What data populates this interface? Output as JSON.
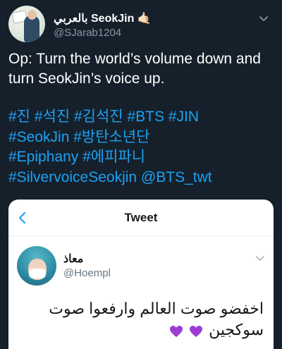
{
  "tweet": {
    "display_name": "بالعربي SeokJin 🤙🏻",
    "handle": "@SJarab1204",
    "text": "Op: Turn the world’s volume down and turn SeokJin’s voice up.",
    "hashtag_lines": [
      "#진 #석진 #김석진 #BTS #JIN",
      "#SeokJin #방탄소년단",
      "#Epiphany #에피파니",
      "#SilvervoiceSeokjin @BTS_twt"
    ]
  },
  "card": {
    "title": "Tweet",
    "quoted": {
      "name": "معاذ",
      "handle": "@Hoempl",
      "text_line1": "اخفضو صوت العالم وارفعوا صوت",
      "text_line2": "سوكجين"
    }
  },
  "colors": {
    "background": "#15202b",
    "link": "#1da1f2",
    "secondary_text": "#8899a6",
    "heart": "#9b3fd4"
  },
  "icons": {
    "header_menu": "chevron-down-icon",
    "card_back": "back-arrow-icon",
    "quoted_menu": "chevron-down-icon",
    "heart": "purple-heart-icon"
  }
}
